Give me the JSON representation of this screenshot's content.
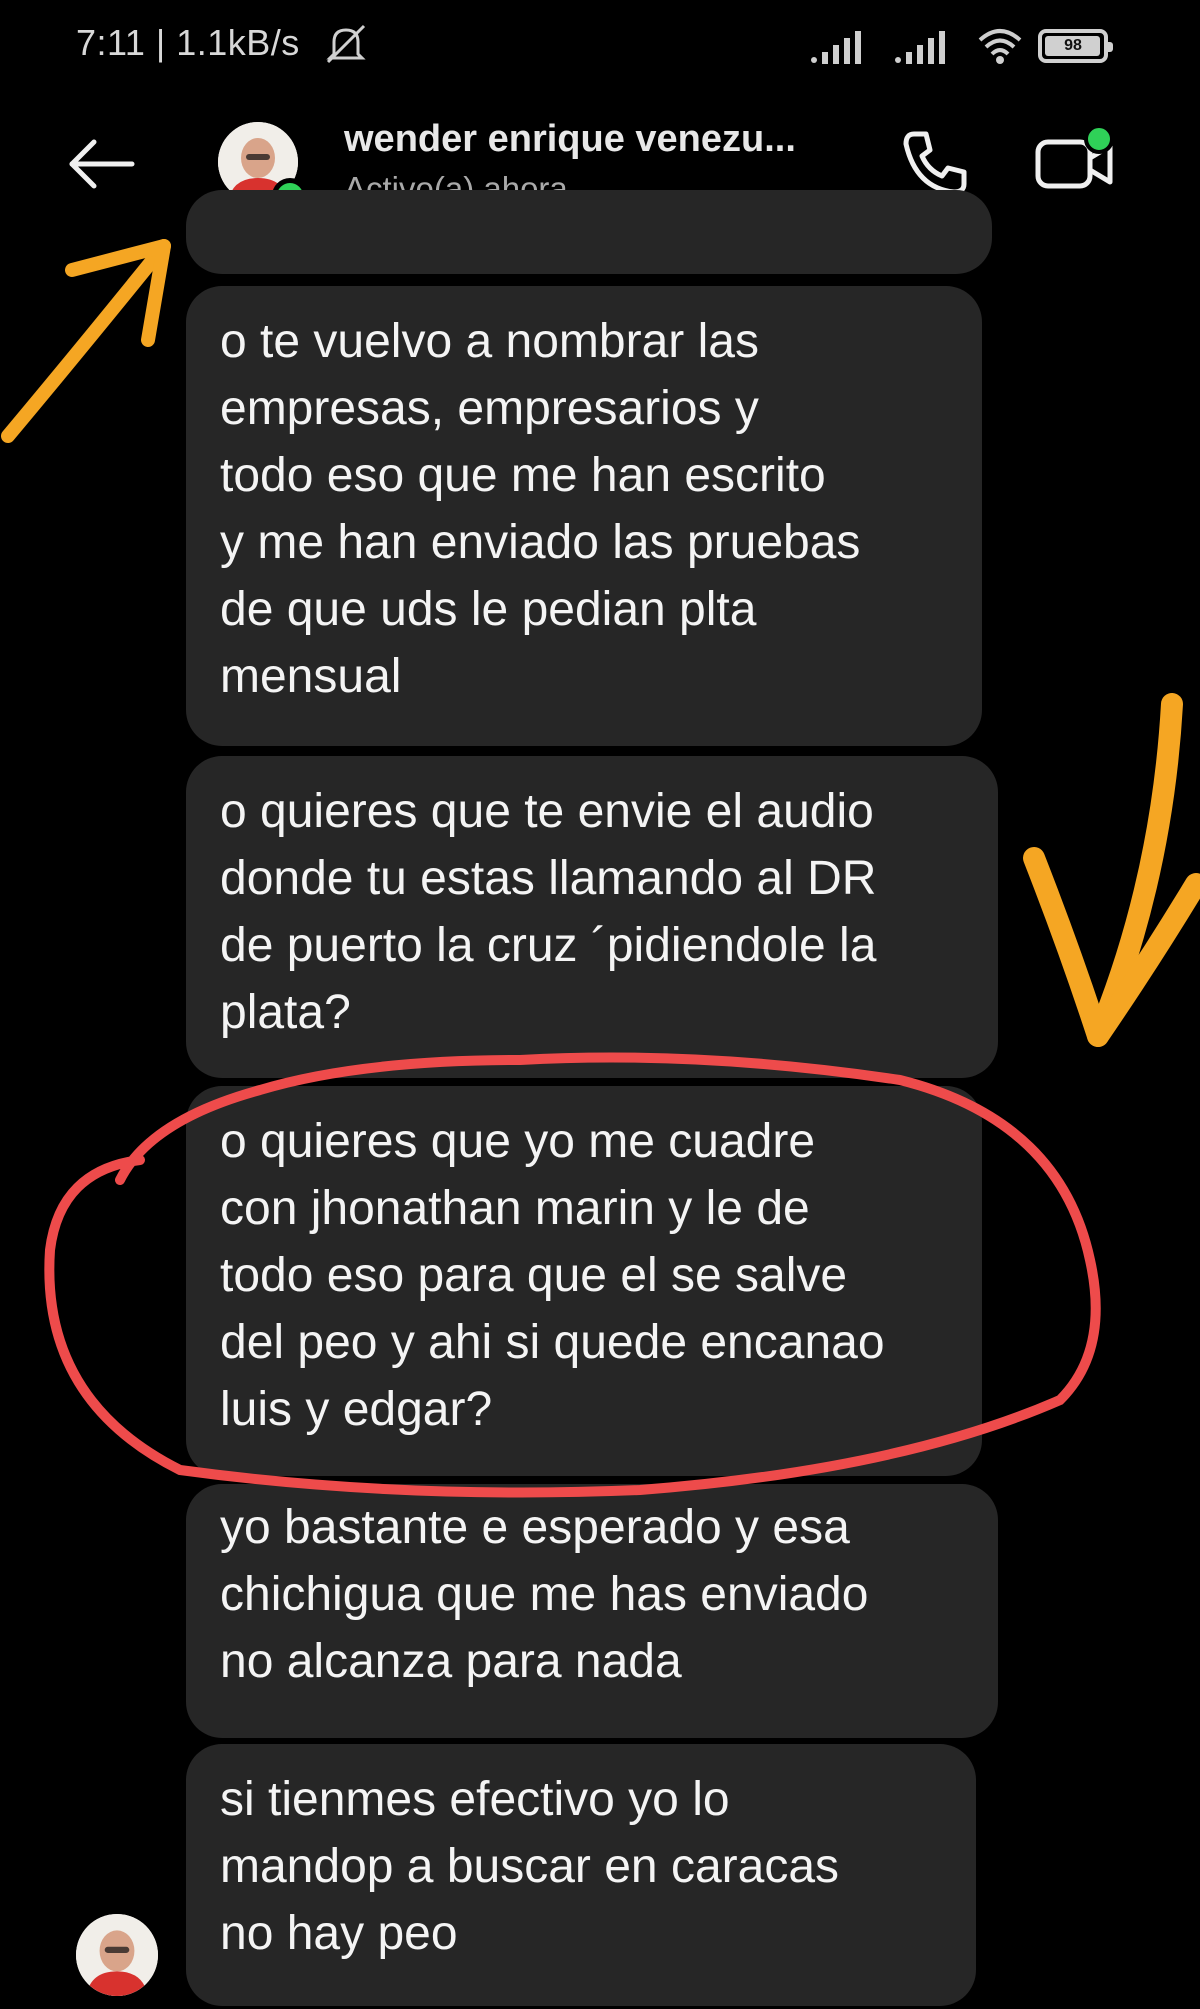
{
  "status_bar": {
    "time_and_speed": "7:11 | 1.1kB/s",
    "mute_icon": "bell-off-icon",
    "signal_icons": [
      "signal-icon",
      "signal-icon"
    ],
    "wifi_icon": "wifi-icon",
    "battery_icon": "battery-icon",
    "battery_level": "98"
  },
  "header": {
    "back_icon": "arrow-left-icon",
    "contact_name": "wender enrique venezu...",
    "contact_status": "Activo(a) ahora",
    "call_icon": "phone-icon",
    "video_icon": "video-camera-icon",
    "online_color": "#2fd158"
  },
  "messages": [
    {
      "text": "o te vuelvo a nombrar las\nempresas, empresarios y\ntodo eso que me han escrito\ny me han enviado las pruebas\nde que uds le pedian plta\nmensual"
    },
    {
      "text": "o quieres que te envie el audio\ndonde tu estas llamando al DR\nde puerto la cruz ´pidiendole la\nplata?"
    },
    {
      "text": "o quieres que yo me cuadre\ncon jhonathan marin y le de\ntodo eso para que el se salve\ndel peo y ahi si quede encanao\nluis y edgar?"
    },
    {
      "text": "yo bastante e esperado y esa\nchichigua que me has enviado\nno alcanza para nada"
    },
    {
      "text": "si tienmes efectivo yo lo\nmandop a buscar en caracas\nno hay peo"
    }
  ],
  "annotation_colors": {
    "arrow": "#f5a623",
    "circle": "#ee4b4b"
  },
  "colors": {
    "background": "#000000",
    "bubble": "#262626"
  }
}
